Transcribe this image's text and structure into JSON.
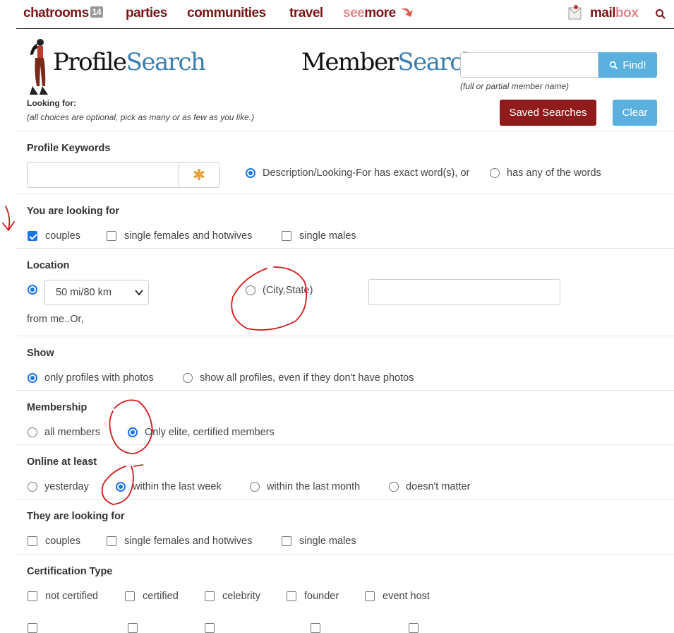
{
  "nav": {
    "chatrooms": "chatrooms",
    "chatrooms_count": "14",
    "parties": "parties",
    "communities": "communities",
    "travel": "travel",
    "see": "see",
    "more": "more",
    "mail": "mail",
    "box": "box"
  },
  "header": {
    "profile_logo_a": "Profile",
    "profile_logo_b": "Search",
    "member_logo_a": "Member",
    "member_logo_b": "Search:",
    "looking_for": "Looking for:",
    "looking_note": "(all choices are optional, pick as many or as few as you like.)",
    "member_input_value": "",
    "find_label": "Find!",
    "member_note": "(full or partial member name)",
    "saved_searches": "Saved Searches",
    "clear": "Clear"
  },
  "keywords": {
    "title": "Profile Keywords",
    "value": "",
    "exact": "Description/Looking-For has exact word(s), or",
    "any": "has any of the words"
  },
  "you_looking": {
    "title": "You are looking for",
    "options": [
      "couples",
      "single females and hotwives",
      "single males"
    ]
  },
  "location": {
    "title": "Location",
    "distance": "50 mi/80 km",
    "city_state": "(City,State)",
    "city_value": "",
    "from_me": "from me..Or,"
  },
  "show": {
    "title": "Show",
    "photos_only": "only profiles with photos",
    "all_profiles": "show all profiles, even if they don't have photos"
  },
  "membership": {
    "title": "Membership",
    "all": "all members",
    "elite": "Only elite, certified members"
  },
  "online": {
    "title": "Online at least",
    "options": [
      "yesterday",
      "within the last week",
      "within the last month",
      "doesn't matter"
    ]
  },
  "they_looking": {
    "title": "They are looking for",
    "options": [
      "couples",
      "single females and hotwives",
      "single males"
    ]
  },
  "certification": {
    "title": "Certification Type",
    "options": [
      "not certified",
      "certified",
      "celebrity",
      "founder",
      "event host"
    ]
  },
  "colors": {
    "nav_dark": "#7a1414",
    "nav_light": "#e08a8a",
    "accent_blue": "#5bb0de",
    "saved_red": "#8f1b1b",
    "annotation_red": "#d11a1a"
  },
  "icons": [
    "search-icon",
    "star-icon",
    "mailbox-icon",
    "arrow-icon",
    "chevron-down-icon"
  ]
}
